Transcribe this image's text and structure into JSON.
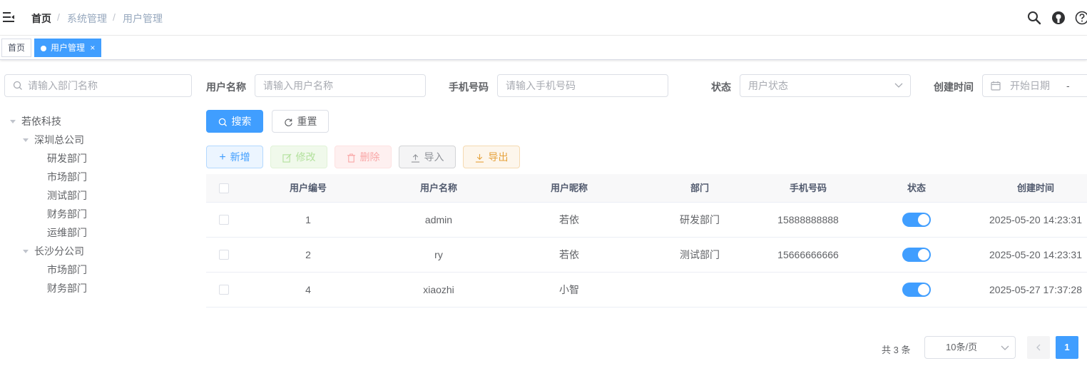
{
  "header": {
    "breadcrumb": [
      "首页",
      "系统管理",
      "用户管理"
    ],
    "separator": "/",
    "icons": [
      "hamburger-icon",
      "search-icon",
      "github-icon",
      "question-icon"
    ]
  },
  "tags": [
    {
      "label": "首页",
      "active": false
    },
    {
      "label": "用户管理",
      "active": true,
      "close": "×"
    }
  ],
  "dept_tree": {
    "search_placeholder": "请输入部门名称",
    "nodes": [
      {
        "label": "若依科技",
        "level": 0,
        "expanded": true
      },
      {
        "label": "深圳总公司",
        "level": 1,
        "expanded": true
      },
      {
        "label": "研发部门",
        "level": 2
      },
      {
        "label": "市场部门",
        "level": 2
      },
      {
        "label": "测试部门",
        "level": 2
      },
      {
        "label": "财务部门",
        "level": 2
      },
      {
        "label": "运维部门",
        "level": 2
      },
      {
        "label": "长沙分公司",
        "level": 1,
        "expanded": true
      },
      {
        "label": "市场部门",
        "level": 2
      },
      {
        "label": "财务部门",
        "level": 2
      }
    ]
  },
  "query": {
    "username_label": "用户名称",
    "username_placeholder": "请输入用户名称",
    "phone_label": "手机号码",
    "phone_placeholder": "请输入手机号码",
    "status_label": "状态",
    "status_placeholder": "用户状态",
    "created_label": "创建时间",
    "start_placeholder": "开始日期",
    "range_sep": "-",
    "search_btn": "搜索",
    "reset_btn": "重置"
  },
  "toolbar": {
    "add": "新增",
    "edit": "修改",
    "delete": "删除",
    "import": "导入",
    "export": "导出"
  },
  "table": {
    "columns": [
      "用户编号",
      "用户名称",
      "用户昵称",
      "部门",
      "手机号码",
      "状态",
      "创建时间"
    ],
    "rows": [
      {
        "id": "1",
        "username": "admin",
        "nickname": "若依",
        "dept": "研发部门",
        "phone": "15888888888",
        "status_on": true,
        "created": "2025-05-20 14:23:31"
      },
      {
        "id": "2",
        "username": "ry",
        "nickname": "若依",
        "dept": "测试部门",
        "phone": "15666666666",
        "status_on": true,
        "created": "2025-05-20 14:23:31"
      },
      {
        "id": "4",
        "username": "xiaozhi",
        "nickname": "小智",
        "dept": "",
        "phone": "",
        "status_on": true,
        "created": "2025-05-27 17:37:28"
      }
    ]
  },
  "pagination": {
    "total_text": "共 3 条",
    "page_size": "10条/页",
    "current_page": "1"
  },
  "colors": {
    "primary": "#409eff",
    "border": "#dcdfe6",
    "header_bg": "#f8f8f9"
  }
}
